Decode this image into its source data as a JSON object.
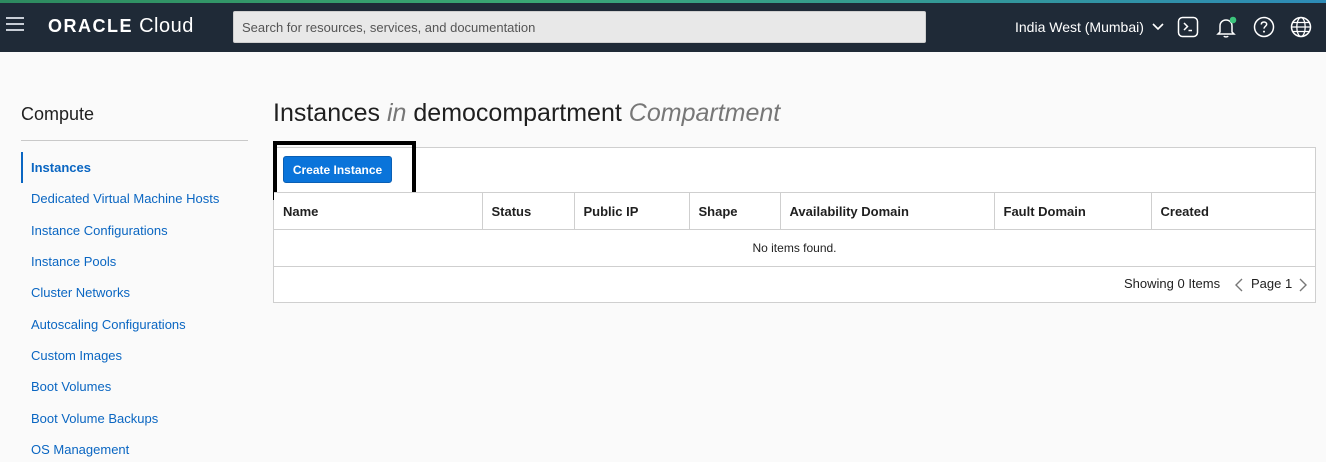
{
  "topbar": {
    "brand": "ORACLE",
    "product": "Cloud",
    "search_placeholder": "Search for resources, services, and documentation",
    "region": "India West (Mumbai)",
    "icons": [
      "menu-icon",
      "cloud-shell-icon",
      "bell-icon",
      "help-icon",
      "globe-icon"
    ]
  },
  "sidebar": {
    "title": "Compute",
    "items": [
      {
        "label": "Instances"
      },
      {
        "label": "Dedicated Virtual Machine Hosts"
      },
      {
        "label": "Instance Configurations"
      },
      {
        "label": "Instance Pools"
      },
      {
        "label": "Cluster Networks"
      },
      {
        "label": "Autoscaling Configurations"
      },
      {
        "label": "Custom Images"
      },
      {
        "label": "Boot Volumes"
      },
      {
        "label": "Boot Volume Backups"
      },
      {
        "label": "OS Management"
      }
    ],
    "active_index": 0
  },
  "main": {
    "title_prefix": "Instances",
    "title_in": "in",
    "compartment": "democompartment",
    "title_suffix": "Compartment",
    "create_button": "Create Instance",
    "columns": [
      "Name",
      "Status",
      "Public IP",
      "Shape",
      "Availability Domain",
      "Fault Domain",
      "Created"
    ],
    "empty_message": "No items found.",
    "showing": "Showing 0 Items",
    "page_label": "Page 1"
  },
  "colors": {
    "topbar_bg": "#1f2a37",
    "link": "#0a66c2",
    "primary_button": "#0a74da",
    "notification_dot": "#3cc47c"
  }
}
